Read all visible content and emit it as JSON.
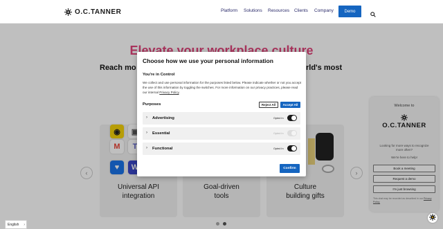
{
  "header": {
    "logo_text": "O.C.TANNER",
    "nav": [
      "Platform",
      "Solutions",
      "Resources",
      "Clients",
      "Company"
    ],
    "demo_label": "Demo"
  },
  "hero": {
    "title": "Elevate your workplace culture",
    "subtitle_left": "Reach mo",
    "subtitle_right": "rld's most"
  },
  "cards": [
    {
      "label_1": "Universal API",
      "label_2": "integration"
    },
    {
      "label_1": "Goal-driven",
      "label_2": "tools"
    },
    {
      "label_1": "Culture",
      "label_2": "building gifts"
    }
  ],
  "carousel": {
    "prev": "‹",
    "next": "›"
  },
  "chat": {
    "welcome": "Welcome to",
    "logo_text": "O.C.TANNER",
    "intro": "Looking for more ways to recognize more often?",
    "help": "We're here to help!",
    "buttons": [
      "Book a meeting",
      "Request a demo",
      "I'm just browsing"
    ],
    "footer": "This chat may be recorded as described in our",
    "footer_link": "Privacy Policy."
  },
  "language": {
    "selected": "English"
  },
  "consent": {
    "title": "Choose how we use your personal information",
    "control_heading": "You're in Control",
    "description": "We collect and use personal information for the purposes listed below. Please indicate whether or not you accept the use of this information by toggling the switches. For more information on our privacy practices, please read our internal",
    "policy_link": "Privacy Policy",
    "purposes_heading": "Purposes",
    "reject_label": "Reject All",
    "accept_label": "Accept All",
    "purposes": [
      {
        "label": "Advertising",
        "status": "Opted In",
        "enabled": true,
        "locked": false
      },
      {
        "label": "Essential",
        "status": "Opted In",
        "enabled": true,
        "locked": true
      },
      {
        "label": "Functional",
        "status": "Opted In",
        "enabled": true,
        "locked": false
      }
    ],
    "confirm_label": "Confirm"
  },
  "colors": {
    "brand_blue": "#1565c0",
    "hero_gradient": "#e0457b"
  }
}
